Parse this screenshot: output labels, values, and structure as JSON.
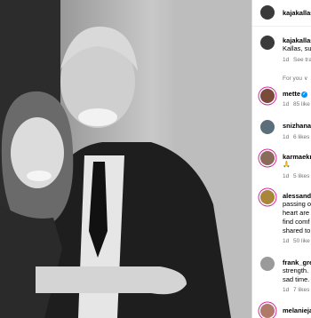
{
  "post": {
    "author": "kajakallas",
    "caption_author": "kajakallas",
    "caption_snippet": "Kallas, sur",
    "caption_time": "1d",
    "see_translation": "See tra",
    "for_you_label": "For you ∨"
  },
  "comments": [
    {
      "username": "mette",
      "verified": true,
      "text": "",
      "time": "1d",
      "likes": "85 like"
    },
    {
      "username": "snizhana_",
      "verified": false,
      "text": "",
      "time": "1d",
      "likes": "6 likes"
    },
    {
      "username": "karmaekr",
      "verified": false,
      "text": "🙏",
      "time": "1d",
      "likes": "5 likes"
    },
    {
      "username": "alessandr",
      "verified": false,
      "lines": [
        "passing o",
        "heart are",
        "find comf",
        "shared to"
      ],
      "time": "1d",
      "likes": "50 like"
    },
    {
      "username": "frank_gre",
      "verified": false,
      "lines": [
        "strength.",
        "sad time."
      ],
      "time": "1d",
      "likes": "7 likes"
    },
    {
      "username": "melanieja",
      "verified": false,
      "text": "",
      "time": "",
      "likes": ""
    }
  ],
  "colors": {
    "story_ring": "#d6249f",
    "verified": "#0095f6",
    "meta": "#737373"
  }
}
